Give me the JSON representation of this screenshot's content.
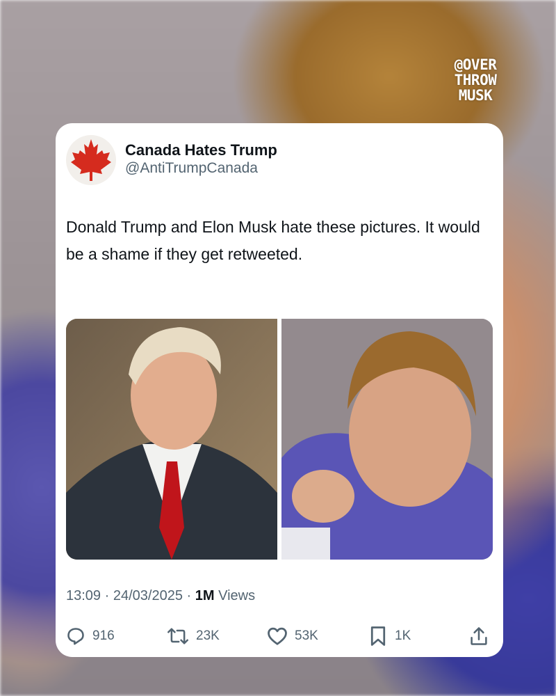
{
  "watermark": {
    "lines": [
      "@OVER",
      "THROW",
      "MUSK"
    ]
  },
  "tweet": {
    "avatar_icon": "maple-leaf-icon",
    "display_name": "Canada Hates Trump",
    "handle": "@AntiTrumpCanada",
    "text": "Donald Trump and Elon Musk hate these pictures. It would be a shame if they get retweeted.",
    "time": "13:09",
    "date": "24/03/2025",
    "separator": "·",
    "views_count": "1M",
    "views_label": "Views"
  },
  "actions": {
    "replies": "916",
    "retweets": "23K",
    "likes": "53K",
    "bookmarks": "1K"
  },
  "colors": {
    "card_bg": "#ffffff",
    "text_primary": "#0f1419",
    "text_secondary": "#536471",
    "maple_red": "#d52b1e"
  }
}
